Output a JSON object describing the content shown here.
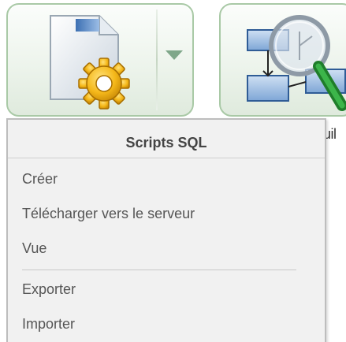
{
  "toolbar": {
    "scripts_button": {
      "icon": "sql-script-gear-icon",
      "has_dropdown": true
    },
    "builder_button": {
      "icon": "query-builder-magnifier-icon",
      "label_fragment": "uil"
    }
  },
  "menu": {
    "title": "Scripts SQL",
    "items": [
      {
        "label": "Créer"
      },
      {
        "label": "Télécharger vers le serveur"
      },
      {
        "label": "Vue"
      },
      {
        "label": "Exporter"
      },
      {
        "label": "Importer"
      }
    ]
  },
  "colors": {
    "button_border": "#a9c9a6",
    "menu_background": "#f1f1f1",
    "menu_border": "#bdbdbd",
    "gear": "#f2b318",
    "magnifier_handle": "#2f9a3a"
  }
}
